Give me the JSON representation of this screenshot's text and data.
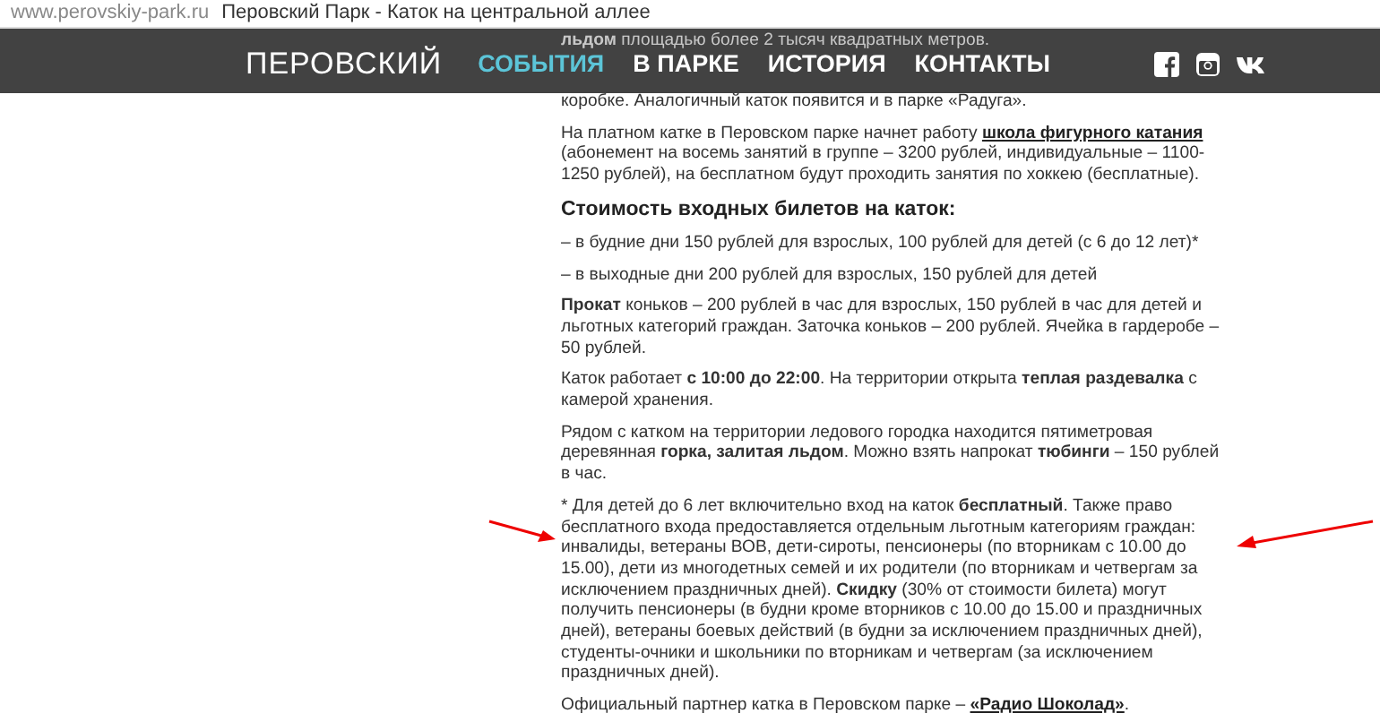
{
  "browser_bar": {
    "url": "www.perovskiy-park.ru",
    "title": "Перовский Парк - Каток на центральной аллее"
  },
  "header": {
    "logo": "ПЕРОВСКИЙ",
    "nav": [
      {
        "label": "СОБЫТИЯ",
        "selected": true
      },
      {
        "label": "В ПАРКЕ",
        "selected": false
      },
      {
        "label": "ИСТОРИЯ",
        "selected": false
      },
      {
        "label": "КОНТАКТЫ",
        "selected": false
      }
    ],
    "social": [
      {
        "kind": "facebook"
      },
      {
        "kind": "instagram"
      },
      {
        "kind": "vk"
      }
    ]
  },
  "covered_lines": [
    [
      {
        "kind": "bold",
        "text": "льдом"
      },
      {
        "kind": "plain",
        "text": " площадью более 2 тысяч квадратных метров."
      }
    ],
    [
      {
        "kind": "plain",
        "text": "коробке. Аналогичный каток появится и в парке «Радуга»."
      }
    ]
  ],
  "article": [
    {
      "kind": "paragraph",
      "segments": [
        {
          "kind": "plain",
          "text": "На платном катке в Перовском парке начнет работу "
        },
        {
          "kind": "link",
          "text": "школа фигурного катания"
        },
        {
          "kind": "plain",
          "text": " (абонемент на восемь занятий в группе – 3200 рублей, индивидуальные – 1100-1250 рублей), на бесплатном будут проходить занятия по хоккею (бесплатные)."
        }
      ]
    },
    {
      "kind": "heading",
      "segments": [
        {
          "kind": "plain",
          "text": "Стоимость входных билетов на каток:"
        }
      ]
    },
    {
      "kind": "paragraph",
      "segments": [
        {
          "kind": "plain",
          "text": "– в будние дни 150 рублей для взрослых, 100 рублей для детей (с 6 до 12 лет)*"
        }
      ]
    },
    {
      "kind": "paragraph",
      "segments": [
        {
          "kind": "plain",
          "text": "– в выходные дни 200 рублей для взрослых, 150 рублей для детей"
        }
      ]
    },
    {
      "kind": "paragraph",
      "segments": [
        {
          "kind": "bold",
          "text": "Прокат"
        },
        {
          "kind": "plain",
          "text": " коньков – 200 рублей в час для взрослых, 150 рублей в час для детей и льготных категорий граждан. Заточка коньков – 200 рублей. Ячейка в гардеробе – 50 рублей."
        }
      ]
    },
    {
      "kind": "paragraph",
      "segments": [
        {
          "kind": "plain",
          "text": "Каток работает "
        },
        {
          "kind": "bold",
          "text": "с 10:00 до 22:00"
        },
        {
          "kind": "plain",
          "text": ". На территории открыта "
        },
        {
          "kind": "bold",
          "text": "теплая раздевалка"
        },
        {
          "kind": "plain",
          "text": " с камерой хранения."
        }
      ]
    },
    {
      "kind": "paragraph",
      "segments": [
        {
          "kind": "plain",
          "text": "Рядом с катком на территории ледового городка находится пятиметровая деревянная "
        },
        {
          "kind": "bold",
          "text": "горка, залитая льдом"
        },
        {
          "kind": "plain",
          "text": ". Можно взять напрокат "
        },
        {
          "kind": "bold",
          "text": "тюбинги"
        },
        {
          "kind": "plain",
          "text": " – 150 рублей в час."
        }
      ]
    },
    {
      "kind": "paragraph",
      "segments": [
        {
          "kind": "plain",
          "text": "* Для детей до 6 лет включительно вход на каток "
        },
        {
          "kind": "bold",
          "text": "бесплатный"
        },
        {
          "kind": "plain",
          "text": ". Также право бесплатного входа предоставляется отдельным льготным категориям граждан: инвалиды, ветераны ВОВ, дети-сироты, пенсионеры (по вторникам с 10.00 до 15.00), дети из многодетных семей и их родители (по вторникам и четвергам за исключением праздничных дней). "
        },
        {
          "kind": "bold",
          "text": "Скидку"
        },
        {
          "kind": "plain",
          "text": " (30% от стоимости билета) могут получить пенсионеры (в будни кроме вторников с 10.00 до 15.00 и праздничных дней), ветераны боевых действий (в будни за исключением праздничных дней), студенты-очники и школьники по вторникам и четвергам (за исключением праздничных дней)."
        }
      ]
    },
    {
      "kind": "paragraph",
      "segments": [
        {
          "kind": "plain",
          "text": "Официальный партнер катка в Перовском парке – "
        },
        {
          "kind": "link",
          "text": "«Радио Шоколад»"
        },
        {
          "kind": "plain",
          "text": "."
        }
      ]
    }
  ]
}
